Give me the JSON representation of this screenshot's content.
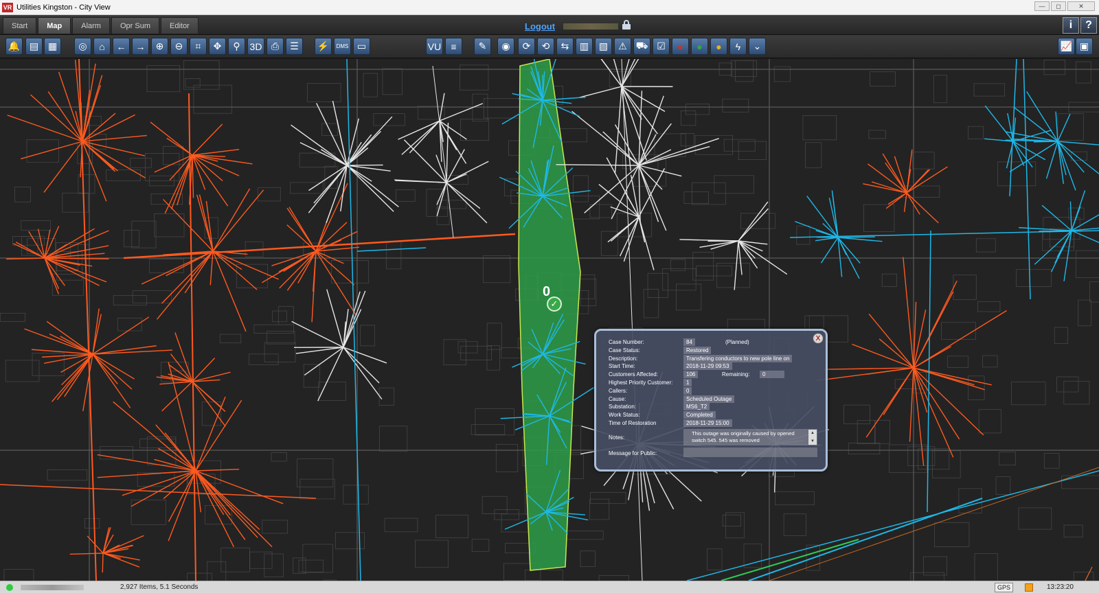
{
  "window": {
    "logo": "VR",
    "title": "Utilities Kingston - City View",
    "controls": [
      "—",
      "◻",
      "✕"
    ]
  },
  "tabs": [
    {
      "label": "Start",
      "active": false
    },
    {
      "label": "Map",
      "active": true
    },
    {
      "label": "Alarm",
      "active": false
    },
    {
      "label": "Opr Sum",
      "active": false
    },
    {
      "label": "Editor",
      "active": false
    }
  ],
  "header": {
    "logout_label": "Logout",
    "info_label": "i",
    "help_label": "?"
  },
  "toolbar": {
    "buttons": [
      {
        "name": "alarm-bell-icon",
        "glyph": "🔔"
      },
      {
        "name": "layers-icon",
        "glyph": "▤"
      },
      {
        "name": "grid-icon",
        "glyph": "▦"
      },
      {
        "name": "globe-icon",
        "glyph": "◎"
      },
      {
        "name": "home-icon",
        "glyph": "⌂"
      },
      {
        "name": "back-arrow-icon",
        "glyph": "←"
      },
      {
        "name": "forward-arrow-icon",
        "glyph": "→"
      },
      {
        "name": "zoom-in-icon",
        "glyph": "⊕"
      },
      {
        "name": "zoom-out-icon",
        "glyph": "⊖"
      },
      {
        "name": "crop-icon",
        "glyph": "⌗"
      },
      {
        "name": "center-icon",
        "glyph": "✥"
      },
      {
        "name": "magnifier-icon",
        "glyph": "⚲"
      },
      {
        "name": "view-3d-icon",
        "glyph": "3D"
      },
      {
        "name": "print-icon",
        "glyph": "⎙"
      },
      {
        "name": "report-icon",
        "glyph": "☰"
      },
      {
        "name": "oms-tool-icon",
        "glyph": "⚡"
      },
      {
        "name": "dms-tool-icon",
        "glyph": "DMS"
      },
      {
        "name": "device-icon",
        "glyph": "▭"
      },
      {
        "name": "vu-icon",
        "glyph": "VU"
      },
      {
        "name": "list-icon",
        "glyph": "≡"
      },
      {
        "name": "pencil-icon",
        "glyph": "✎"
      },
      {
        "name": "map-pin-icon",
        "glyph": "◉"
      },
      {
        "name": "switch-open-icon",
        "glyph": "⟳"
      },
      {
        "name": "switch-close-icon",
        "glyph": "⟲"
      },
      {
        "name": "transfer-icon",
        "glyph": "⇆"
      },
      {
        "name": "panel-icon",
        "glyph": "▥"
      },
      {
        "name": "panel-alt-icon",
        "glyph": "▧"
      },
      {
        "name": "warning-icon",
        "glyph": "⚠"
      },
      {
        "name": "truck-icon",
        "glyph": "⛟"
      },
      {
        "name": "checklist-icon",
        "glyph": "☑"
      },
      {
        "name": "red-marker-icon",
        "glyph": "●"
      },
      {
        "name": "green-marker-icon",
        "glyph": "●"
      },
      {
        "name": "yellow-marker-icon",
        "glyph": "●"
      },
      {
        "name": "lightning-icon",
        "glyph": "ϟ"
      },
      {
        "name": "chevron-down-icon",
        "glyph": "⌄"
      },
      {
        "name": "trend-chart-icon",
        "glyph": "📈"
      },
      {
        "name": "export-icon",
        "glyph": "▣"
      }
    ]
  },
  "outage": {
    "customers_marker": "0",
    "fields": [
      {
        "label": "Case Number:",
        "value": "84",
        "extra": "(Planned)"
      },
      {
        "label": "Case Status:",
        "value": "Restored"
      },
      {
        "label": "Description:",
        "value": "Transfering conductors to new pole line on"
      },
      {
        "label": "Start Time:",
        "value": "2018-11-29 09:53"
      },
      {
        "label": "Customers Affected:",
        "value": "106",
        "extra_label": "Remaining:",
        "extra_value": "0"
      },
      {
        "label": "Highest Priority Customer:",
        "value": "1"
      },
      {
        "label": "Callers:",
        "value": "0"
      },
      {
        "label": "Cause:",
        "value": "Scheduled Outage"
      },
      {
        "label": "Substation:",
        "value": "MS6_T2"
      },
      {
        "label": "Work Status:",
        "value": "Completed"
      },
      {
        "label": "Time of Restoration",
        "value": "2018-11-29 15:00"
      }
    ],
    "notes_label": "Notes:",
    "notes_value": "This outage was originally caused by opened switch 545. 545 was removed",
    "message_label": "Message for Public:",
    "message_value": ""
  },
  "status": {
    "items_text": "2,927 Items, 5.1 Seconds",
    "gps_label": "GPS",
    "clock": "13:23:20"
  },
  "colors": {
    "orange": "#ff5a1f",
    "white": "#e6e6e6",
    "cyan": "#1fb8e8",
    "green_zone": "#2e9e48",
    "grid": "#4a4a4a"
  }
}
